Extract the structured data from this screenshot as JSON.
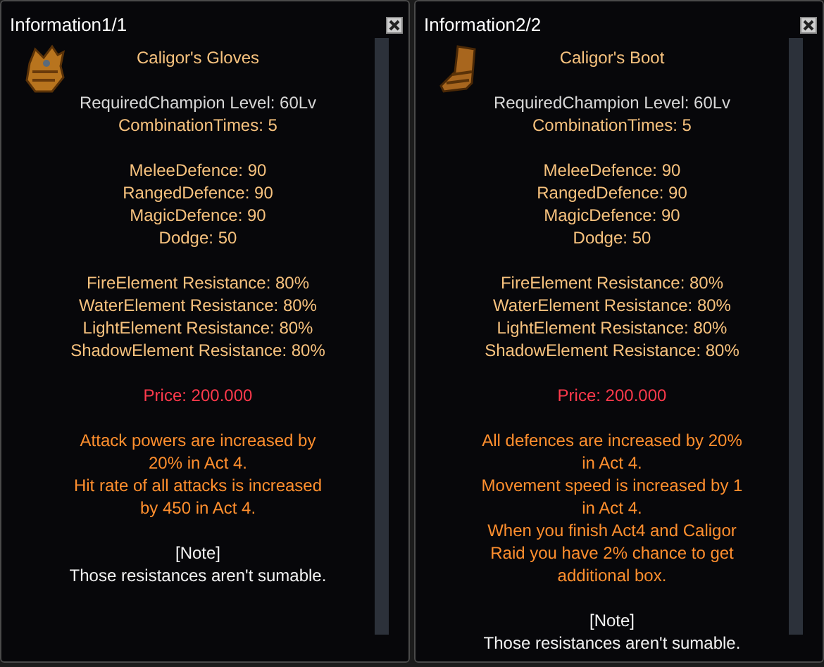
{
  "panels": [
    {
      "title": "Information1/1",
      "item": {
        "kind": "glove",
        "name": "Caligor's Gloves"
      },
      "sections": [
        [
          {
            "kind": "info",
            "text": "RequiredChampion Level: 60Lv"
          },
          {
            "kind": "stat",
            "text": "CombinationTimes: 5"
          }
        ],
        [
          {
            "kind": "stat",
            "text": "MeleeDefence: 90"
          },
          {
            "kind": "stat",
            "text": "RangedDefence: 90"
          },
          {
            "kind": "stat",
            "text": "MagicDefence: 90"
          },
          {
            "kind": "stat",
            "text": "Dodge: 50"
          }
        ],
        [
          {
            "kind": "stat",
            "text": "FireElement Resistance: 80%"
          },
          {
            "kind": "stat",
            "text": "WaterElement Resistance: 80%"
          },
          {
            "kind": "stat",
            "text": "LightElement Resistance: 80%"
          },
          {
            "kind": "stat",
            "text": "ShadowElement Resistance: 80%"
          }
        ],
        [
          {
            "kind": "price",
            "text": "Price: 200.000"
          }
        ],
        [
          {
            "kind": "effect",
            "text": "Attack powers are increased by 20% in Act 4."
          },
          {
            "kind": "effect",
            "text": "Hit rate of all attacks is increased by 450 in Act 4."
          }
        ],
        [
          {
            "kind": "note",
            "text": "[Note]"
          },
          {
            "kind": "note",
            "text": "Those resistances aren't sumable."
          }
        ]
      ]
    },
    {
      "title": "Information2/2",
      "item": {
        "kind": "boot",
        "name": "Caligor's Boot"
      },
      "sections": [
        [
          {
            "kind": "info",
            "text": "RequiredChampion Level: 60Lv"
          },
          {
            "kind": "stat",
            "text": "CombinationTimes: 5"
          }
        ],
        [
          {
            "kind": "stat",
            "text": "MeleeDefence: 90"
          },
          {
            "kind": "stat",
            "text": "RangedDefence: 90"
          },
          {
            "kind": "stat",
            "text": "MagicDefence: 90"
          },
          {
            "kind": "stat",
            "text": "Dodge: 50"
          }
        ],
        [
          {
            "kind": "stat",
            "text": "FireElement Resistance: 80%"
          },
          {
            "kind": "stat",
            "text": "WaterElement Resistance: 80%"
          },
          {
            "kind": "stat",
            "text": "LightElement Resistance: 80%"
          },
          {
            "kind": "stat",
            "text": "ShadowElement Resistance: 80%"
          }
        ],
        [
          {
            "kind": "price",
            "text": "Price: 200.000"
          }
        ],
        [
          {
            "kind": "effect",
            "text": "All defences are increased by 20% in Act 4."
          },
          {
            "kind": "effect",
            "text": "Movement speed is increased by 1 in Act 4."
          },
          {
            "kind": "effect",
            "text": "When you finish Act4 and Caligor Raid you have 2% chance to get additional box."
          }
        ],
        [
          {
            "kind": "note",
            "text": "[Note]"
          },
          {
            "kind": "note",
            "text": "Those resistances aren't sumable."
          }
        ]
      ]
    }
  ]
}
